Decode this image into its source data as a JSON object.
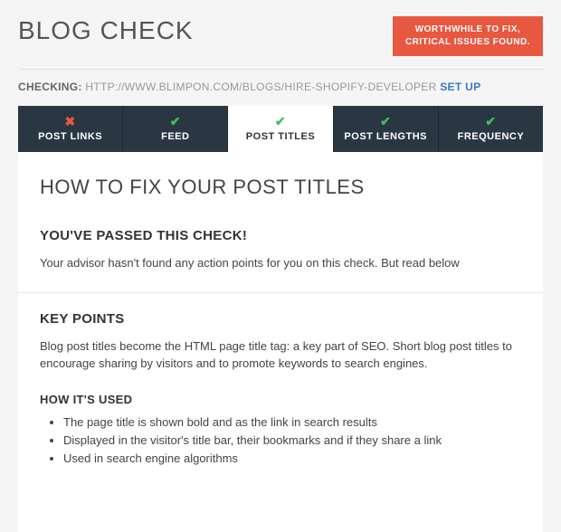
{
  "header": {
    "brand": "BLOG CHECK",
    "status_line1": "WORTHWHILE TO FIX,",
    "status_line2": "CRITICAL ISSUES FOUND."
  },
  "checking": {
    "label": "CHECKING:",
    "url": "HTTP://WWW.BLIMPON.COM/BLOGS/HIRE-SHOPIFY-DEVELOPER",
    "setup": "SET UP"
  },
  "tabs": [
    {
      "label": "POST LINKS",
      "status": "fail",
      "active": false
    },
    {
      "label": "FEED",
      "status": "ok",
      "active": false
    },
    {
      "label": "POST TITLES",
      "status": "ok",
      "active": true
    },
    {
      "label": "POST LENGTHS",
      "status": "ok",
      "active": false
    },
    {
      "label": "FREQUENCY",
      "status": "ok",
      "active": false
    }
  ],
  "content": {
    "heading": "HOW TO FIX YOUR POST TITLES",
    "passed_title": "YOU'VE PASSED THIS CHECK!",
    "passed_body": "Your advisor hasn't found any action points for you on this check. But read below",
    "keypoints_title": "KEY POINTS",
    "keypoints_body": "Blog post titles become the HTML page title tag: a key part of SEO. Short blog post titles to encourage sharing by visitors and to promote keywords to search engines.",
    "howused_title": "HOW IT'S USED",
    "howused_items": [
      "The page title is shown bold and as the link in search results",
      "Displayed in the visitor's title bar, their bookmarks and if they share a link",
      "Used in search engine algorithms"
    ]
  }
}
